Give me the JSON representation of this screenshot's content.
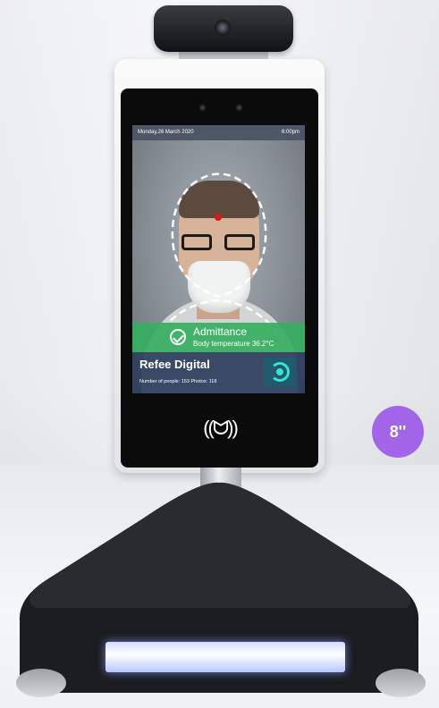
{
  "screen": {
    "date": "Monday,26 March 2020",
    "time": "6:00pm",
    "status": "Admittance",
    "temperature_text": "Body temperature 36.2°C",
    "brand": "Refee Digital",
    "stats": "Number of people: 153    Photos: 118",
    "nfc_symbol": "((ᗢ))"
  },
  "badge": {
    "size_label": "8''"
  },
  "colors": {
    "admit_green": "#36ae60",
    "info_panel": "#2c3e5c",
    "badge_purple": "#a265e8",
    "light_bar": "#c4ceff"
  }
}
